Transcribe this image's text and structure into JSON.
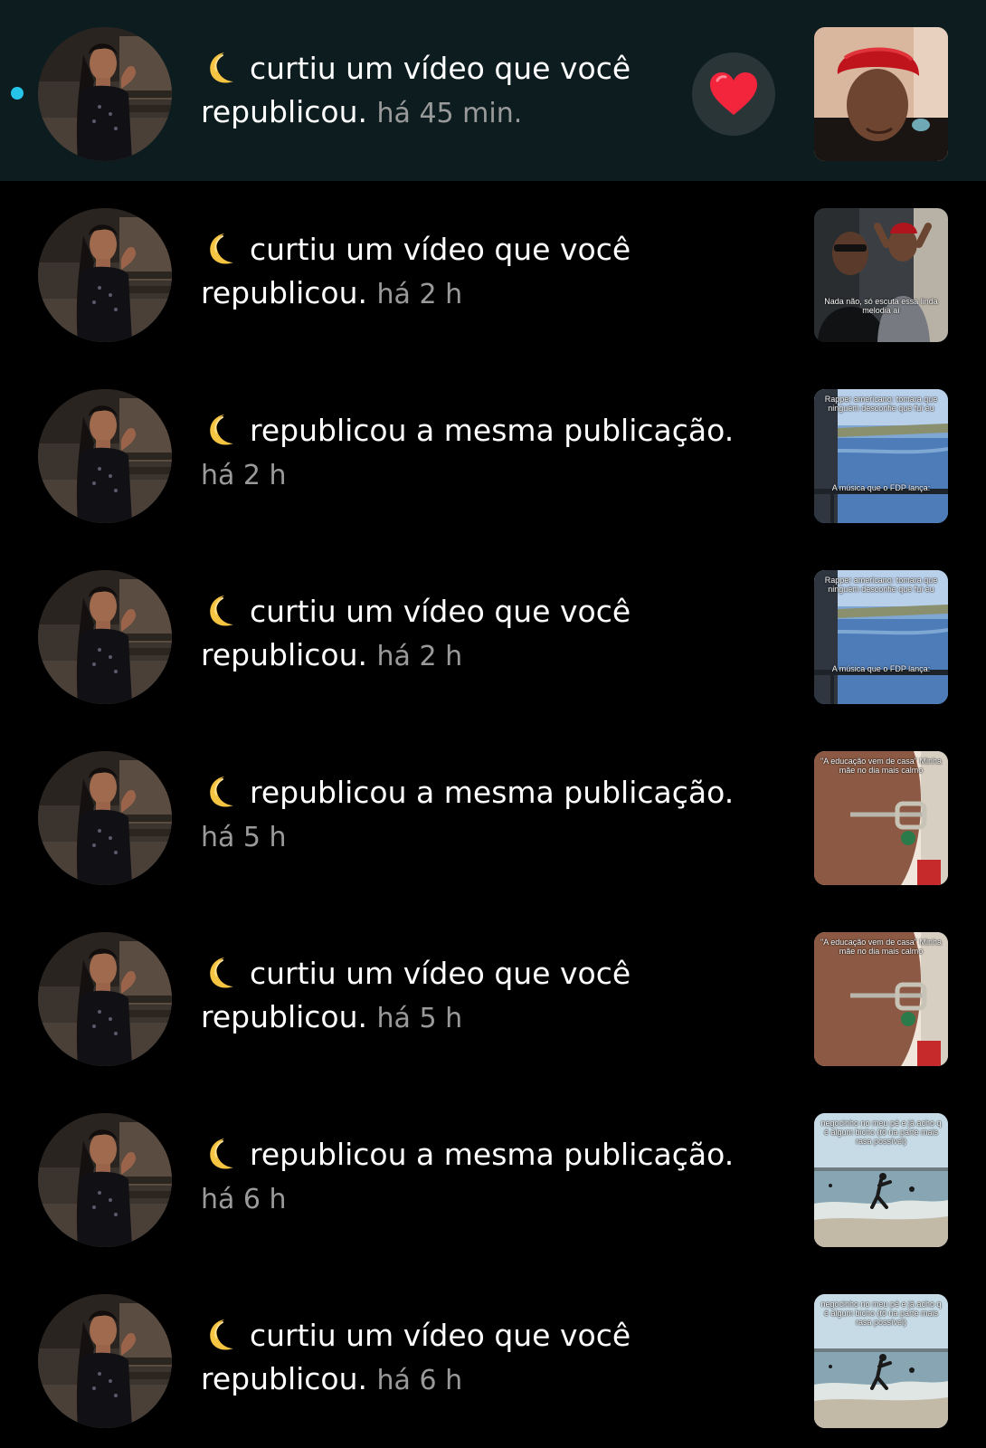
{
  "notifications": [
    {
      "unread": true,
      "action": "curtiu um vídeo que você republicou.",
      "time": "há 45 min.",
      "liked_icon": "heart-icon",
      "thumb": {
        "kind": "portrait-red",
        "caption_top": "",
        "caption_bottom": ""
      }
    },
    {
      "unread": false,
      "action": "curtiu um vídeo que você republicou.",
      "time": "há 2 h",
      "thumb": {
        "kind": "two-men",
        "caption_top": "",
        "caption_bottom": "Nada não, só escuta essa linda melodia aí"
      }
    },
    {
      "unread": false,
      "action": "republicou a mesma publicação.",
      "time": "há 2 h",
      "thumb": {
        "kind": "river",
        "caption_top": "Rapper americano: tomara que ninguém desconfie que fui eu",
        "caption_bottom": "A música que o FDP lança:"
      }
    },
    {
      "unread": false,
      "action": "curtiu um vídeo que você republicou.",
      "time": "há 2 h",
      "thumb": {
        "kind": "river",
        "caption_top": "Rapper americano: tomara que ninguém desconfie que fui eu",
        "caption_bottom": "A música que o FDP lança:"
      }
    },
    {
      "unread": false,
      "action": "republicou a mesma publicação.",
      "time": "há 5 h",
      "thumb": {
        "kind": "glasses",
        "caption_top": "\"A educação vem de casa\" Minha mãe no dia mais calmo",
        "caption_bottom": ""
      }
    },
    {
      "unread": false,
      "action": "curtiu um vídeo que você republicou.",
      "time": "há 5 h",
      "thumb": {
        "kind": "glasses",
        "caption_top": "\"A educação vem de casa\" Minha mãe no dia mais calmo",
        "caption_bottom": ""
      }
    },
    {
      "unread": false,
      "action": "republicou a mesma publicação.",
      "time": "há 6 h",
      "thumb": {
        "kind": "beach",
        "caption_top": "negocinho no meu pé e já acho q é algum bicho (tô na parte mais rasa possível)",
        "caption_bottom": ""
      }
    },
    {
      "unread": false,
      "action": "curtiu um vídeo que você republicou.",
      "time": "há 6 h",
      "thumb": {
        "kind": "beach",
        "caption_top": "negocinho no meu pé e já acho q é algum bicho (tô na parte mais rasa possível)",
        "caption_bottom": ""
      }
    }
  ],
  "icons": {
    "user_emoji": "crescent-moon-icon",
    "like": "heart-icon"
  },
  "colors": {
    "background": "#000000",
    "unread_row": "#0c1c1f",
    "unread_dot": "#25c4e8",
    "time_text": "#9a9a9a",
    "heart": "#f2253d"
  }
}
